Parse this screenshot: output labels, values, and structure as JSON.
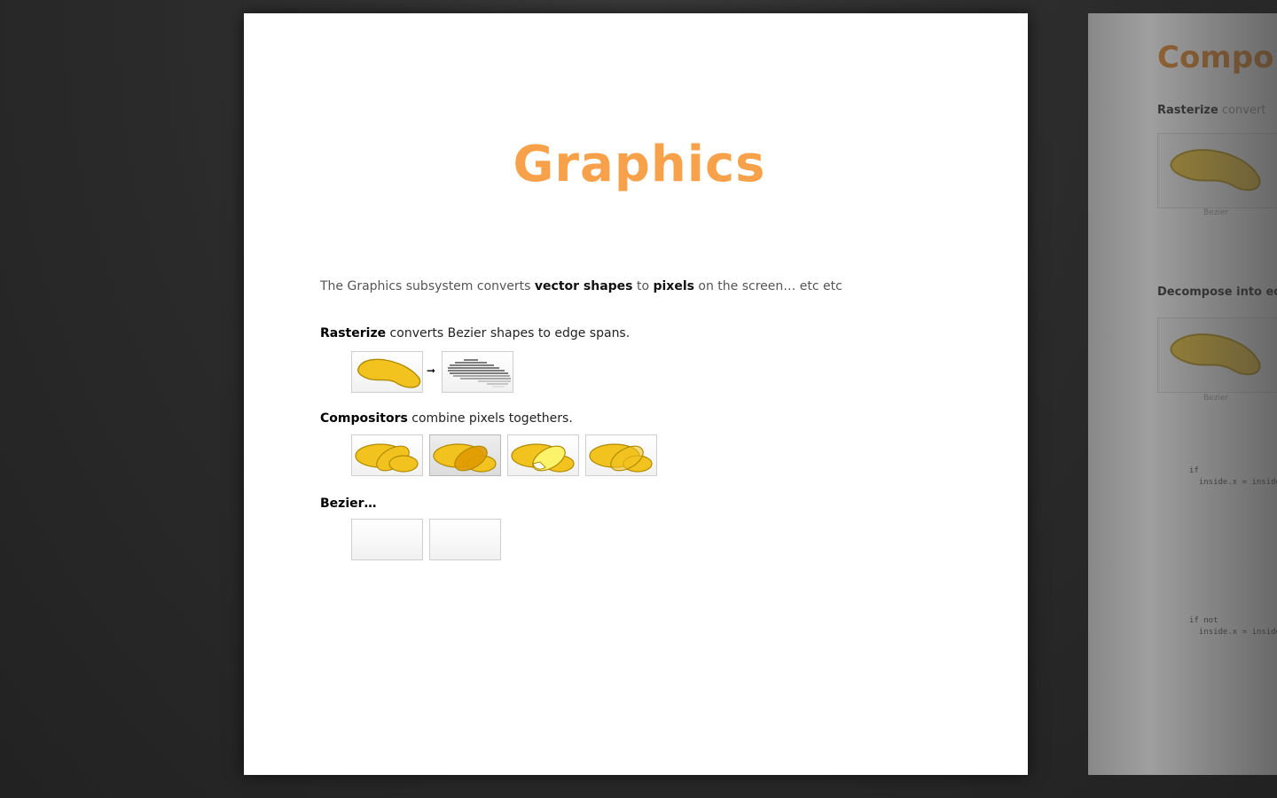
{
  "slide": {
    "title": "Graphics",
    "intro": {
      "prefix": "The Graphics subsystem converts ",
      "bold1": "vector shapes",
      "mid": " to ",
      "bold2": "pixels",
      "suffix": " on the screen…  etc etc"
    },
    "sections": [
      {
        "bold": "Rasterize",
        "text": " converts Bezier shapes to edge spans."
      },
      {
        "bold": "Compositors",
        "text": " combine pixels togethers."
      },
      {
        "bold": "Bezier…",
        "text": ""
      }
    ],
    "arrow": "➞"
  },
  "next_slide": {
    "title": "Compo",
    "labels": [
      {
        "bold": "Rasterize",
        "text": " convert"
      },
      {
        "bold": "Decompose into ed",
        "text": ""
      }
    ],
    "captions": [
      "Bezier",
      "Bezier"
    ],
    "code": [
      "if\n  inside.x = inside",
      "if not\n  inside.x = inside"
    ]
  },
  "colors": {
    "title": "#f7a24b",
    "shape_fill": "#f2c21f",
    "shape_stroke": "#b08a00",
    "shape_dark": "#e09a00",
    "shape_light": "#fdf36a"
  }
}
